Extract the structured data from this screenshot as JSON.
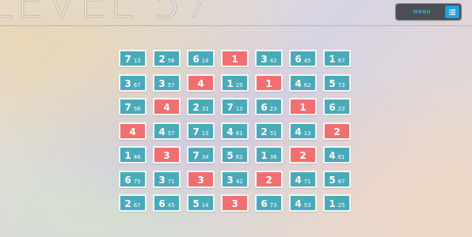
{
  "header": {
    "level_title": "LEVEL 57",
    "menu_label": "MENU",
    "menu_icon": "list-icon"
  },
  "colors": {
    "teal_tile": "#4aaab9",
    "red_tile": "#f07071",
    "menu_accent": "#1ea3e0",
    "menu_bg": "#4a4f55"
  },
  "grid": {
    "rows": [
      [
        {
          "value": "7",
          "sub": "13",
          "color": "teal"
        },
        {
          "value": "2",
          "sub": "56",
          "color": "teal"
        },
        {
          "value": "6",
          "sub": "14",
          "color": "teal"
        },
        {
          "value": "1",
          "sub": "",
          "color": "red"
        },
        {
          "value": "3",
          "sub": "42",
          "color": "teal"
        },
        {
          "value": "6",
          "sub": "45",
          "color": "teal"
        },
        {
          "value": "1",
          "sub": "67",
          "color": "teal"
        }
      ],
      [
        {
          "value": "3",
          "sub": "67",
          "color": "teal"
        },
        {
          "value": "3",
          "sub": "57",
          "color": "teal"
        },
        {
          "value": "4",
          "sub": "",
          "color": "red"
        },
        {
          "value": "1",
          "sub": "25",
          "color": "teal"
        },
        {
          "value": "1",
          "sub": "",
          "color": "red"
        },
        {
          "value": "4",
          "sub": "62",
          "color": "teal"
        },
        {
          "value": "5",
          "sub": "73",
          "color": "teal"
        }
      ],
      [
        {
          "value": "7",
          "sub": "56",
          "color": "teal"
        },
        {
          "value": "4",
          "sub": "",
          "color": "red"
        },
        {
          "value": "2",
          "sub": "31",
          "color": "teal"
        },
        {
          "value": "7",
          "sub": "13",
          "color": "teal"
        },
        {
          "value": "6",
          "sub": "23",
          "color": "teal"
        },
        {
          "value": "1",
          "sub": "",
          "color": "red"
        },
        {
          "value": "6",
          "sub": "23",
          "color": "teal"
        }
      ],
      [
        {
          "value": "4",
          "sub": "",
          "color": "red"
        },
        {
          "value": "4",
          "sub": "57",
          "color": "teal"
        },
        {
          "value": "7",
          "sub": "13",
          "color": "teal"
        },
        {
          "value": "4",
          "sub": "61",
          "color": "teal"
        },
        {
          "value": "2",
          "sub": "51",
          "color": "teal"
        },
        {
          "value": "4",
          "sub": "13",
          "color": "teal"
        },
        {
          "value": "2",
          "sub": "",
          "color": "red"
        }
      ],
      [
        {
          "value": "1",
          "sub": "46",
          "color": "teal"
        },
        {
          "value": "3",
          "sub": "",
          "color": "red"
        },
        {
          "value": "7",
          "sub": "34",
          "color": "teal"
        },
        {
          "value": "5",
          "sub": "62",
          "color": "teal"
        },
        {
          "value": "1",
          "sub": "36",
          "color": "teal"
        },
        {
          "value": "2",
          "sub": "",
          "color": "red"
        },
        {
          "value": "4",
          "sub": "61",
          "color": "teal"
        }
      ],
      [
        {
          "value": "6",
          "sub": "75",
          "color": "teal"
        },
        {
          "value": "3",
          "sub": "71",
          "color": "teal"
        },
        {
          "value": "3",
          "sub": "",
          "color": "red"
        },
        {
          "value": "3",
          "sub": "42",
          "color": "teal"
        },
        {
          "value": "2",
          "sub": "",
          "color": "red"
        },
        {
          "value": "4",
          "sub": "71",
          "color": "teal"
        },
        {
          "value": "5",
          "sub": "67",
          "color": "teal"
        }
      ],
      [
        {
          "value": "2",
          "sub": "67",
          "color": "teal"
        },
        {
          "value": "6",
          "sub": "45",
          "color": "teal"
        },
        {
          "value": "5",
          "sub": "14",
          "color": "teal"
        },
        {
          "value": "3",
          "sub": "",
          "color": "red"
        },
        {
          "value": "6",
          "sub": "73",
          "color": "teal"
        },
        {
          "value": "4",
          "sub": "53",
          "color": "teal"
        },
        {
          "value": "1",
          "sub": "25",
          "color": "teal"
        }
      ]
    ]
  }
}
